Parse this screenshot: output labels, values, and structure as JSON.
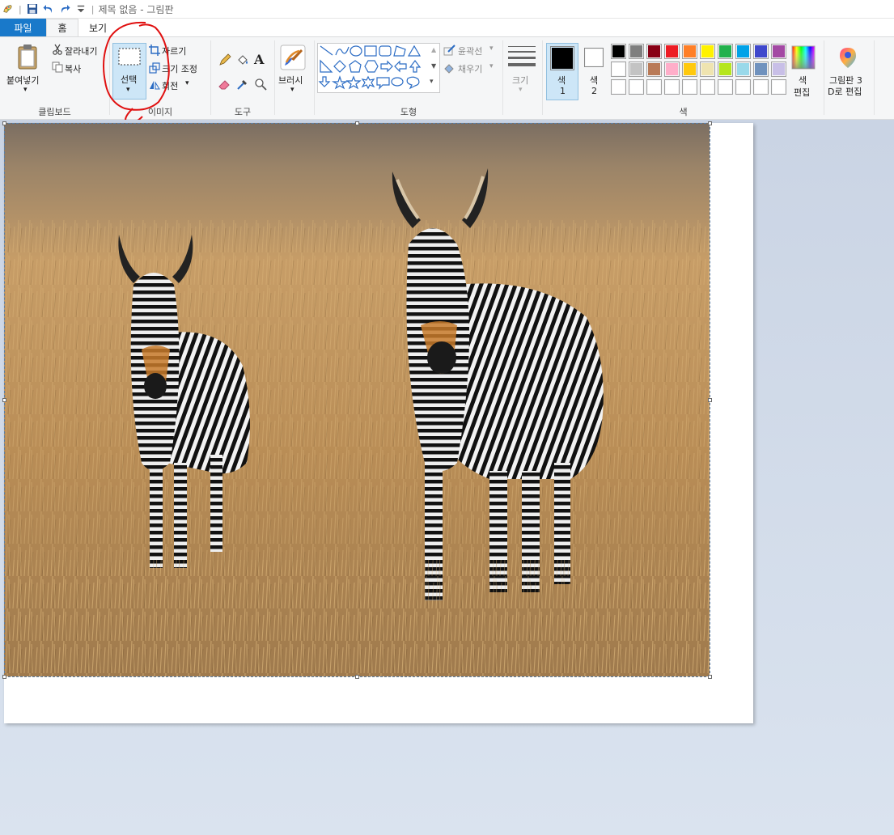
{
  "title": {
    "text": "제목 없음 - 그림판"
  },
  "tabs": {
    "file": "파일",
    "home": "홈",
    "view": "보기"
  },
  "clipboard": {
    "paste": "붙여넣기",
    "cut": "잘라내기",
    "copy": "복사",
    "group_label": "클립보드"
  },
  "image": {
    "select": "선택",
    "crop": "자르기",
    "resize": "크기 조정",
    "rotate": "회전",
    "group_label": "이미지"
  },
  "tools": {
    "group_label": "도구",
    "text_glyph": "A"
  },
  "brushes": {
    "label": "브러시"
  },
  "shapes": {
    "outline": "윤곽선",
    "fill": "채우기",
    "group_label": "도형"
  },
  "size": {
    "label": "크기"
  },
  "colors": {
    "color1_label": "색",
    "color1_num": "1",
    "color2_label": "색",
    "color2_num": "2",
    "edit_line1": "색",
    "edit_line2": "편집",
    "group_label": "색",
    "color1": "#000000",
    "color2": "#ffffff",
    "palette_row1": [
      "#000000",
      "#7f7f7f",
      "#880015",
      "#ed1c24",
      "#ff7f27",
      "#fff200",
      "#22b14c",
      "#00a2e8",
      "#3f48cc",
      "#a349a4"
    ],
    "palette_row2": [
      "#ffffff",
      "#c3c3c3",
      "#b97a57",
      "#ffaec9",
      "#ffc90e",
      "#efe4b0",
      "#b5e61d",
      "#99d9ea",
      "#7092be",
      "#c8bfe7"
    ],
    "palette_row3": [
      "#ffffff",
      "#ffffff",
      "#ffffff",
      "#ffffff",
      "#ffffff",
      "#ffffff",
      "#ffffff",
      "#ffffff",
      "#ffffff",
      "#ffffff"
    ]
  },
  "paint3d": {
    "line1": "그림판 3",
    "line2": "D로 편집"
  },
  "canvas": {
    "image_subject": "two zebras in golden grassland"
  }
}
